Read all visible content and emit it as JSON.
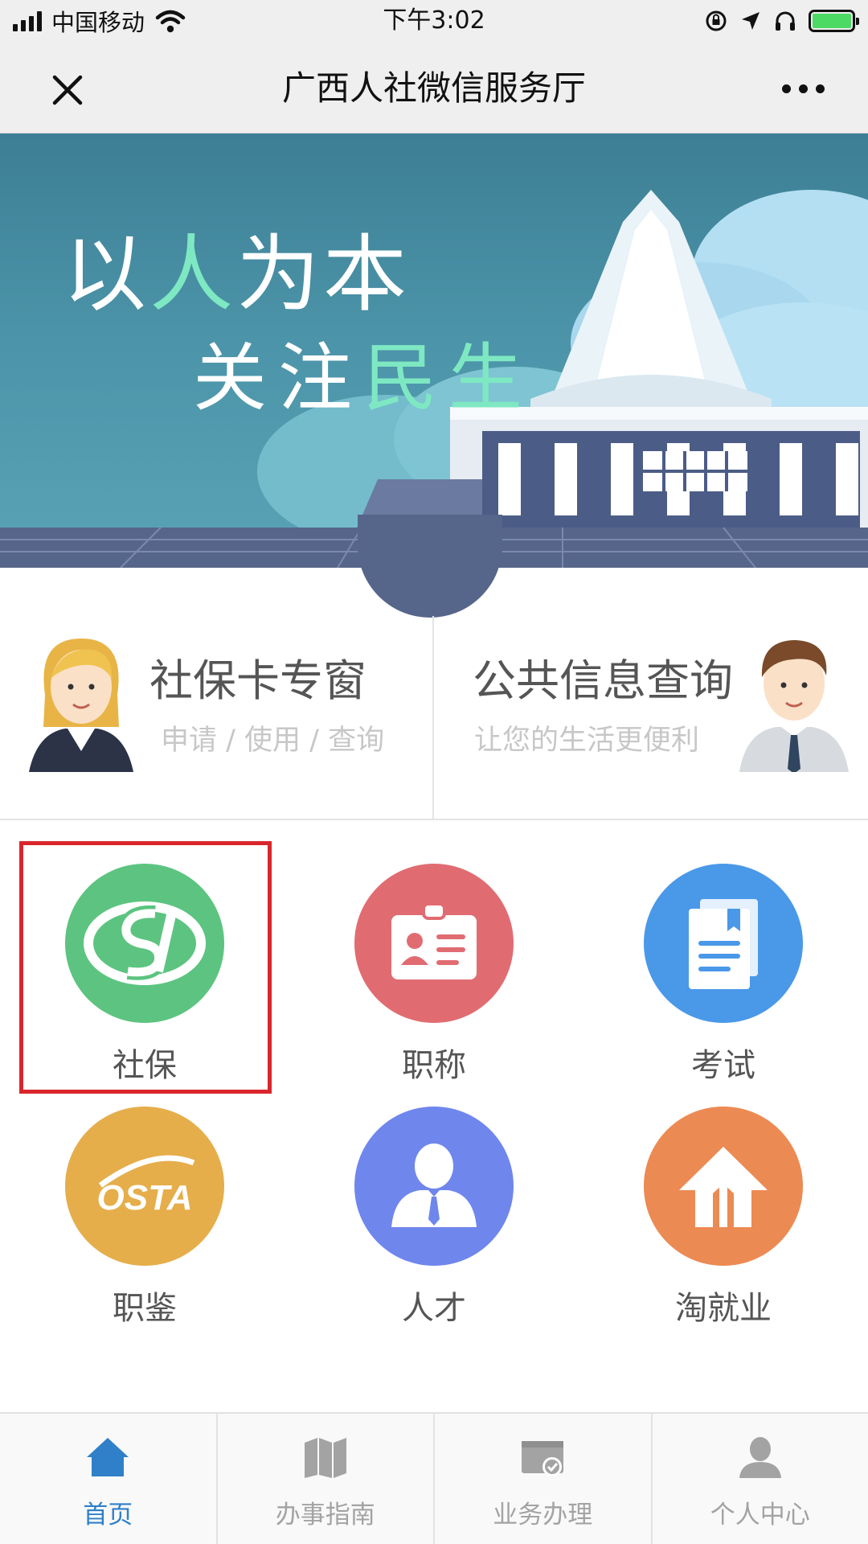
{
  "status_bar": {
    "carrier": "中国移动",
    "time": "下午3:02"
  },
  "nav": {
    "title": "广西人社微信服务厅"
  },
  "banner": {
    "slogan_line1_a": "以",
    "slogan_line1_b": "人",
    "slogan_line1_c": "为本",
    "slogan_line2_a": "关注",
    "slogan_line2_b": "民生"
  },
  "quick_cards": [
    {
      "title": "社保卡专窗",
      "subtitle": "申请 / 使用 / 查询"
    },
    {
      "title": "公共信息查询",
      "subtitle": "让您的生活更便利"
    }
  ],
  "services": [
    {
      "label": "社保",
      "icon": "social-security-si-icon",
      "color": "#5cc480",
      "highlighted": true
    },
    {
      "label": "职称",
      "icon": "id-badge-icon",
      "color": "#e06c72"
    },
    {
      "label": "考试",
      "icon": "document-icon",
      "color": "#4a98e8"
    },
    {
      "label": "职鉴",
      "icon": "osta-logo-icon",
      "color": "#e5ae4b",
      "logo_text": "OSTA"
    },
    {
      "label": "人才",
      "icon": "person-icon",
      "color": "#6f86ec"
    },
    {
      "label": "淘就业",
      "icon": "house-arrow-icon",
      "color": "#ec8a53"
    }
  ],
  "tabs": [
    {
      "label": "首页",
      "icon": "home-icon",
      "active": true
    },
    {
      "label": "办事指南",
      "icon": "map-icon",
      "active": false
    },
    {
      "label": "业务办理",
      "icon": "briefcase-check-icon",
      "active": false
    },
    {
      "label": "个人中心",
      "icon": "user-icon",
      "active": false
    }
  ],
  "colors": {
    "accent_tab": "#2f80c8",
    "highlight_box": "#d9262b",
    "banner_accent": "#7ee8c2"
  }
}
